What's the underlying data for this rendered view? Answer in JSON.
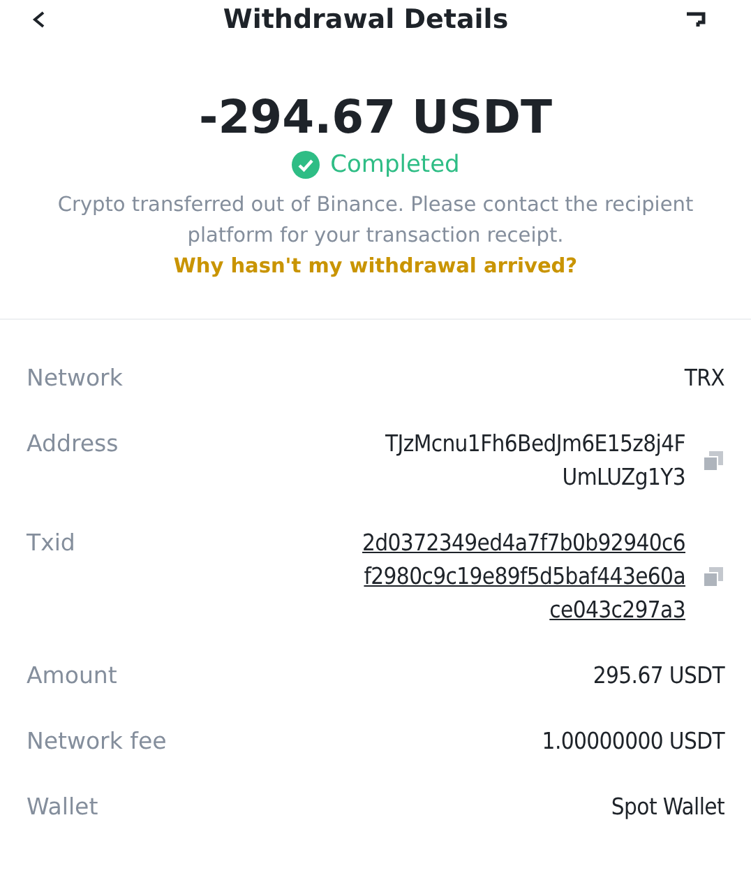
{
  "header": {
    "title": "Withdrawal Details"
  },
  "summary": {
    "amount": "-294.67 USDT",
    "status": "Completed",
    "note": "Crypto transferred out of Binance. Please contact the recipient platform for your transaction receipt.",
    "link": "Why hasn't my withdrawal arrived?"
  },
  "details": [
    {
      "label": "Network",
      "lines": [
        "TRX"
      ],
      "copyable": false,
      "link": false
    },
    {
      "label": "Address",
      "lines": [
        "TJzMcnu1Fh6BedJm6E15z8j4F",
        "UmLUZg1Y3"
      ],
      "copyable": true,
      "link": false
    },
    {
      "label": "Txid",
      "lines": [
        "2d0372349ed4a7f7b0b92940c6",
        "f2980c9c19e89f5d5baf443e60a",
        "ce043c297a3"
      ],
      "copyable": true,
      "link": true
    },
    {
      "label": "Amount",
      "lines": [
        "295.67 USDT"
      ],
      "copyable": false,
      "link": false
    },
    {
      "label": "Network fee",
      "lines": [
        "1.00000000 USDT"
      ],
      "copyable": false,
      "link": false
    },
    {
      "label": "Wallet",
      "lines": [
        "Spot Wallet"
      ],
      "copyable": false,
      "link": false
    }
  ]
}
